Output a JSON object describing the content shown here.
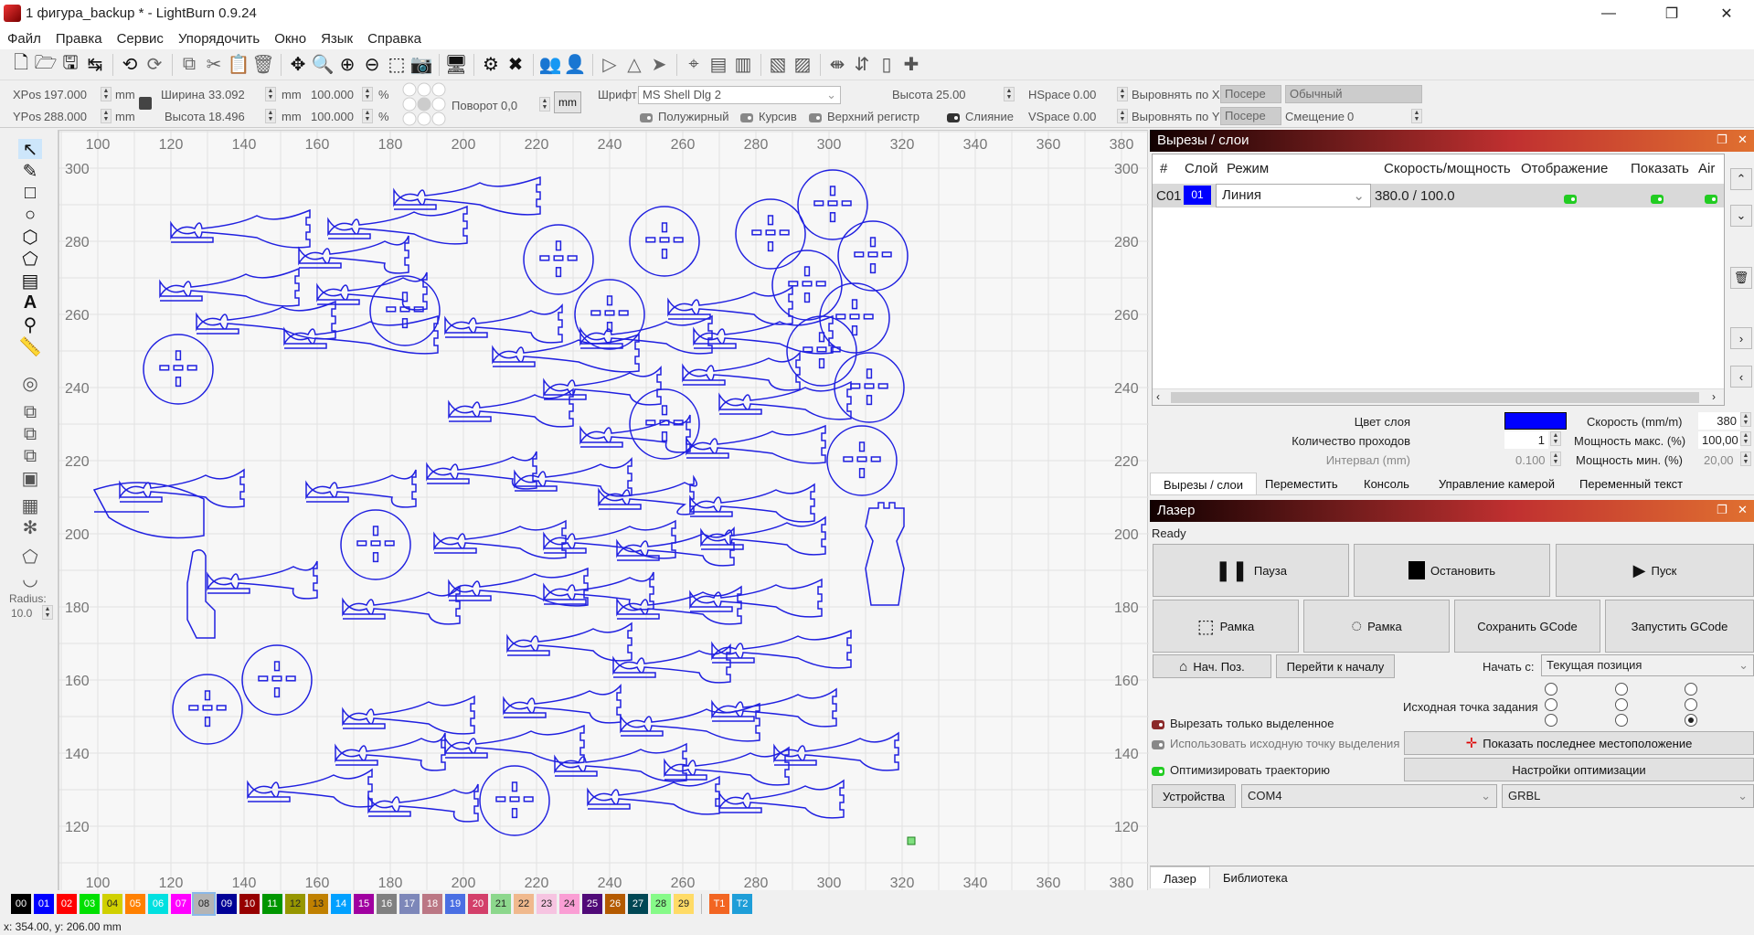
{
  "window": {
    "title": "1 фигура_backup * - LightBurn 0.9.24",
    "minimize_icon": "minimize-icon",
    "maximize_icon": "restore-icon",
    "close_icon": "close-icon"
  },
  "menu": [
    "Файл",
    "Правка",
    "Сервис",
    "Упорядочить",
    "Окно",
    "Язык",
    "Справка"
  ],
  "toolbar": {
    "icons": [
      "new-file-icon",
      "open-folder-icon",
      "save-icon",
      "save-as-icon",
      "undo-icon",
      "redo-icon",
      "copy-icon",
      "cut-icon",
      "paste-icon",
      "delete-icon",
      "move-icon",
      "zoom-fit-icon",
      "zoom-in-icon",
      "zoom-out-icon",
      "zoom-selection-icon",
      "camera-icon",
      "monitor-icon",
      "settings-icon",
      "tools-icon",
      "group-icon",
      "ungroup-icon",
      "flip-horizontal-icon",
      "mirror-icon",
      "rotate-icon",
      "center-icon",
      "align-left-icon",
      "align-right-icon",
      "align-top-icon",
      "align-bottom-icon",
      "distribute-h-icon",
      "distribute-v-icon",
      "resize-icon",
      "move-laser-icon"
    ]
  },
  "props": {
    "xpos_label": "XPos",
    "xpos": "197.000",
    "ypos_label": "YPos",
    "ypos": "288.000",
    "unit": "mm",
    "width_label": "Ширина",
    "width": "33.092",
    "height_label": "Высота",
    "height": "18.496",
    "scale_x": "100.000",
    "scale_y": "100.000",
    "percent": "%",
    "rotate_label": "Поворот",
    "rotate": "0,0",
    "mm_button": "mm",
    "font_label": "Шрифт",
    "font": "MS Shell Dlg 2",
    "text_height_label": "Высота",
    "text_height": "25.00",
    "hspace_label": "HSpace",
    "hspace": "0.00",
    "vspace_label": "VSpace",
    "vspace": "0.00",
    "align_x_label": "Выровнять по X",
    "align_x": "Посере",
    "align_y_label": "Выровнять по Y",
    "align_y": "Посере",
    "style": "Обычный",
    "offset_label": "Смещение",
    "offset": "0",
    "bold": "Полужирный",
    "italic": "Курсив",
    "upper": "Верхний регистр",
    "weld": "Слияние"
  },
  "left_tools": {
    "icons": [
      "select-icon",
      "pencil-icon",
      "rectangle-icon",
      "ellipse-icon",
      "polygon-icon",
      "edit-nodes-icon",
      "trim-icon",
      "text-icon",
      "position-laser-icon",
      "measure-icon",
      "offset-icon",
      "boolean-union-icon",
      "boolean-difference-icon",
      "boolean-intersect-icon",
      "weld-icon",
      "grid-array-icon",
      "circular-array-icon",
      "convert-to-path-icon",
      "corner-radius-icon"
    ],
    "radius_label": "Radius:",
    "radius": "10.0"
  },
  "canvas": {
    "x_ticks": [
      "100",
      "120",
      "140",
      "160",
      "180",
      "200",
      "220",
      "240",
      "260",
      "280",
      "300",
      "320",
      "340",
      "360",
      "380"
    ],
    "y_ticks": [
      "300",
      "280",
      "260",
      "240",
      "220",
      "200",
      "180",
      "160",
      "140",
      "120"
    ],
    "shape_color": "#2020e0"
  },
  "cuts_panel": {
    "title": "Вырезы / слои",
    "columns": [
      "#",
      "Слой",
      "Режим",
      "Скорость/мощность",
      "Отображение",
      "Показать",
      "Air"
    ],
    "rows": [
      {
        "id": "C01",
        "layer": "01",
        "layer_color": "#0000ff",
        "mode": "Линия",
        "speed_power": "380.0 / 100.0"
      }
    ],
    "layer_color_label": "Цвет слоя",
    "speed_label": "Скорость (mm/m)",
    "speed": "380",
    "passes_label": "Количество проходов",
    "passes": "1",
    "max_power_label": "Мощность макс. (%)",
    "max_power": "100,00",
    "interval_label": "Интервал (mm)",
    "interval": "0.100",
    "min_power_label": "Мощность мин. (%)",
    "min_power": "20,00",
    "tabs": [
      "Вырезы / слои",
      "Переместить",
      "Консоль",
      "Управление камерой",
      "Переменный текст"
    ]
  },
  "laser_panel": {
    "title": "Лазер",
    "status": "Ready",
    "pause": "Пауза",
    "stop": "Остановить",
    "start": "Пуск",
    "frame1": "Рамка",
    "frame2": "Рамка",
    "save_gcode": "Сохранить GCode",
    "run_gcode": "Запустить GCode",
    "home": "Нач. Поз.",
    "go_origin": "Перейти к началу",
    "start_from_label": "Начать с:",
    "start_from": "Текущая позиция",
    "job_origin_label": "Исходная точка задания",
    "job_origin_selected": 8,
    "cut_selected": "Вырезать только выделенное",
    "use_selection_origin": "Использовать исходную точку выделения",
    "optimize": "Оптимизировать траекторию",
    "show_last_position": "Показать последнее местоположение",
    "optimization_settings": "Настройки оптимизации",
    "devices": "Устройства",
    "port": "COM4",
    "controller": "GRBL",
    "tabs": [
      "Лазер",
      "Библиотека"
    ]
  },
  "palette": [
    {
      "label": "00",
      "color": "#000000"
    },
    {
      "label": "01",
      "color": "#0000ff"
    },
    {
      "label": "02",
      "color": "#ff0000"
    },
    {
      "label": "03",
      "color": "#00e000"
    },
    {
      "label": "04",
      "color": "#d0d000"
    },
    {
      "label": "05",
      "color": "#ff8000"
    },
    {
      "label": "06",
      "color": "#00e0e0"
    },
    {
      "label": "07",
      "color": "#ff00ff"
    },
    {
      "label": "08",
      "color": "#b4b4b4"
    },
    {
      "label": "09",
      "color": "#000096"
    },
    {
      "label": "10",
      "color": "#960000"
    },
    {
      "label": "11",
      "color": "#009600"
    },
    {
      "label": "12",
      "color": "#969600"
    },
    {
      "label": "13",
      "color": "#c08000"
    },
    {
      "label": "14",
      "color": "#00a0ff"
    },
    {
      "label": "15",
      "color": "#a000a0"
    },
    {
      "label": "16",
      "color": "#808080"
    },
    {
      "label": "17",
      "color": "#7d87b9"
    },
    {
      "label": "18",
      "color": "#bb7784"
    },
    {
      "label": "19",
      "color": "#4a6fe3"
    },
    {
      "label": "20",
      "color": "#d33f6a"
    },
    {
      "label": "21",
      "color": "#8cd78c"
    },
    {
      "label": "22",
      "color": "#f0b98d"
    },
    {
      "label": "23",
      "color": "#f6c4e1"
    },
    {
      "label": "24",
      "color": "#fa9ed4"
    },
    {
      "label": "25",
      "color": "#500a78"
    },
    {
      "label": "26",
      "color": "#b45a00"
    },
    {
      "label": "27",
      "color": "#004754"
    },
    {
      "label": "28",
      "color": "#86fa88"
    },
    {
      "label": "29",
      "color": "#ffdb66"
    },
    {
      "label": "T1",
      "color": "#f26522"
    },
    {
      "label": "T2",
      "color": "#1e9ed8"
    }
  ],
  "status": "x: 354.00, y: 206.00 mm"
}
